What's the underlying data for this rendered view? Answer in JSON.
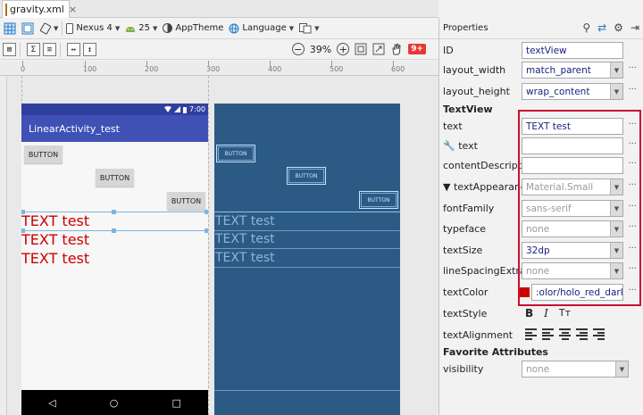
{
  "tab": {
    "filename": "gravity.xml"
  },
  "toolbar": {
    "device": "Nexus 4",
    "api_level": "25",
    "theme": "AppTheme",
    "language": "Language",
    "zoom_level": "39%",
    "warning_badge": "9+"
  },
  "ruler": {
    "ticks": [
      "0",
      "100",
      "200",
      "300",
      "400",
      "500",
      "600"
    ]
  },
  "design": {
    "status_time": "7:00",
    "app_title": "LinearActivity_test",
    "buttons": [
      "BUTTON",
      "BUTTON",
      "BUTTON"
    ],
    "texts": [
      "TEXT test",
      "TEXT test",
      "TEXT test"
    ],
    "nav_back": "◁",
    "nav_home": "○",
    "nav_recent": "□"
  },
  "properties": {
    "title": "Properties",
    "id_label": "ID",
    "id_value": "textView",
    "layout_width_label": "layout_width",
    "layout_width_value": "match_parent",
    "layout_height_label": "layout_height",
    "layout_height_value": "wrap_content",
    "section_textview": "TextView",
    "text_label": "text",
    "text_value": "TEXT test",
    "tools_text_label": "text",
    "tools_text_value": "",
    "content_desc_label": "contentDescription",
    "content_desc_value": "",
    "text_appearance_label": "textAppearance",
    "text_appearance_value": "Material.Small",
    "font_family_label": "fontFamily",
    "font_family_value": "sans-serif",
    "typeface_label": "typeface",
    "typeface_value": "none",
    "text_size_label": "textSize",
    "text_size_value": "32dp",
    "line_spacing_label": "lineSpacingExtra",
    "line_spacing_value": "none",
    "text_color_label": "textColor",
    "text_color_value": ":olor/holo_red_dark",
    "text_style_label": "textStyle",
    "text_alignment_label": "textAlignment",
    "section_favorite": "Favorite Attributes",
    "visibility_label": "visibility",
    "visibility_value": "none",
    "more": "···"
  },
  "colors": {
    "accent_red": "#cc0000",
    "highlight_box": "#c8102e",
    "appbar": "#3f51b5",
    "blueprint": "#2b5b85"
  }
}
